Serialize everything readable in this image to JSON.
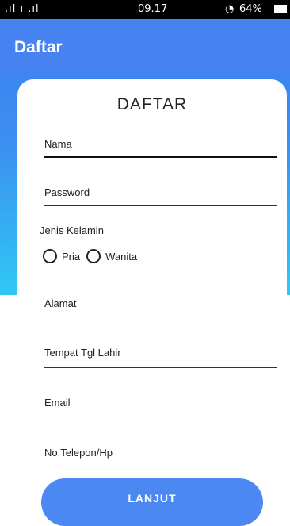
{
  "status_bar": {
    "signal": ".ıl ı .ıl",
    "time": "09.17",
    "battery": "64%"
  },
  "app_bar": {
    "title": "Daftar"
  },
  "form": {
    "heading": "DAFTAR",
    "fields": {
      "nama": "Nama",
      "password": "Password",
      "alamat": "Alamat",
      "tempat_tgl_lahir": "Tempat Tgl Lahir",
      "email": "Email",
      "telepon": "No.Telepon/Hp"
    },
    "gender": {
      "label": "Jenis Kelamin",
      "options": [
        "Pria",
        "Wanita"
      ]
    },
    "submit_label": "LANJUT"
  }
}
